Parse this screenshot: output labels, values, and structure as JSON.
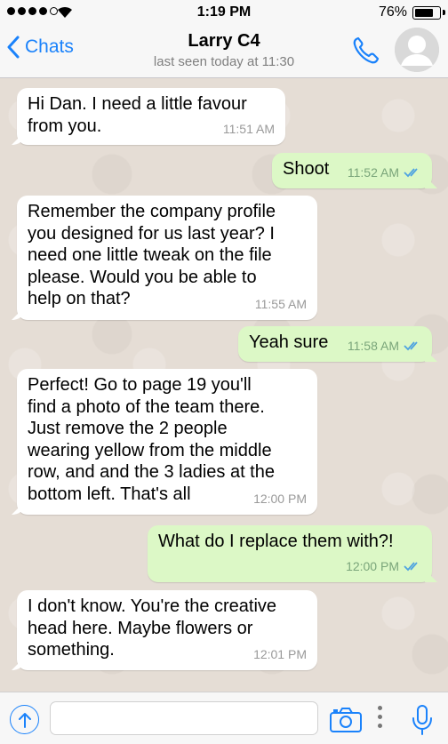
{
  "status_bar": {
    "time": "1:19 PM",
    "battery": "76%",
    "battery_level": 0.76
  },
  "header": {
    "back_label": "Chats",
    "contact_name": "Larry C4",
    "contact_status": "last seen today at 11:30"
  },
  "messages": [
    {
      "direction": "in",
      "text": "Hi Dan. I need a little favour\nfrom you.",
      "time": "11:51 AM"
    },
    {
      "direction": "out",
      "text": "Shoot",
      "time": "11:52 AM",
      "read": true
    },
    {
      "direction": "in",
      "text": "Remember the company profile\nyou designed for us last year? I\nneed one little tweak on the file\nplease. Would you be able to\nhelp on that?",
      "time": "11:55 AM"
    },
    {
      "direction": "out",
      "text": "Yeah sure",
      "time": "11:58 AM",
      "read": true
    },
    {
      "direction": "in",
      "text": "Perfect! Go to page 19 you'll\nfind a photo of the team there.\nJust remove the 2 people\nwearing yellow from the middle\nrow, and and the 3 ladies at the\nbottom left. That's all",
      "time": "12:00 PM"
    },
    {
      "direction": "out",
      "text": "What do I replace them with?!",
      "time": "12:00 PM",
      "read": true
    },
    {
      "direction": "in",
      "text": "I don't know. You're the creative\nhead here. Maybe flowers or\nsomething.",
      "time": "12:01 PM"
    }
  ],
  "input": {
    "value": "",
    "placeholder": ""
  },
  "colors": {
    "accent": "#1a82fb",
    "outgoing_bubble": "#dcf8c6",
    "incoming_bubble": "#ffffff",
    "read_ticks": "#4fa3e0",
    "chat_background": "#e5ddd5"
  },
  "icons": {
    "back": "chevron-left-icon",
    "call": "phone-icon",
    "avatar": "default-avatar-icon",
    "upload": "arrow-up-circle-icon",
    "camera": "camera-icon",
    "more": "more-vertical-icon",
    "mic": "microphone-icon",
    "read": "double-check-icon"
  }
}
